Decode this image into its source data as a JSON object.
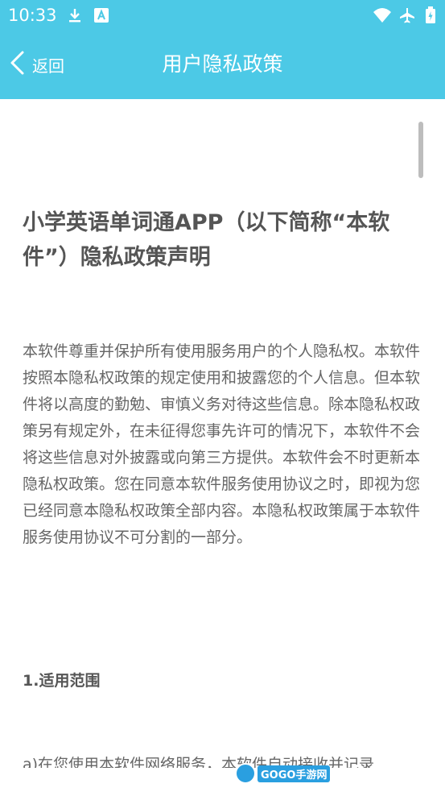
{
  "status_bar": {
    "time": "10:33",
    "icons": [
      "download-icon",
      "text-a-icon",
      "wifi-icon",
      "airplane-icon",
      "battery-icon"
    ]
  },
  "toolbar": {
    "back_label": "返回",
    "title": "用户隐私政策"
  },
  "document": {
    "title": "小学英语单词通APP（以下简称“本软件”）隐私政策声明",
    "paragraph": "本软件尊重并保护所有使用服务用户的个人隐私权。本软件按照本隐私权政策的规定使用和披露您的个人信息。但本软件将以高度的勤勉、审慎义务对待这些信息。除本隐私权政策另有规定外，在未征得您事先许可的情况下，本软件不会将这些信息对外披露或向第三方提供。本软件会不时更新本隐私权政策。您在同意本软件服务使用协议之时，即视为您已经同意本隐私权政策全部内容。本隐私权政策属于本软件服务使用协议不可分割的一部分。",
    "section_heading": "1.适用范围",
    "cut_line": "a)在您使用本软件网络服务，本软件自动接收并记录"
  },
  "watermark": {
    "text": "GOGO手游网"
  },
  "colors": {
    "appbar": "#4cc9e6",
    "title_text": "#555555",
    "body_text": "#666666"
  }
}
